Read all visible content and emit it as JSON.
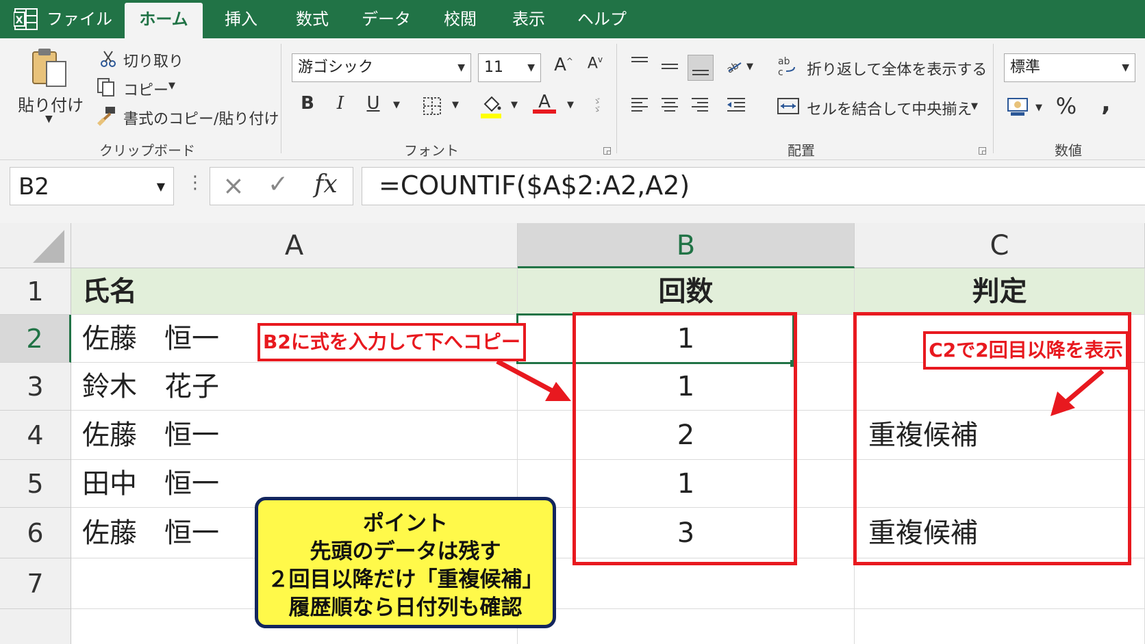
{
  "window": {
    "icon": "excel-logo-icon"
  },
  "tabs": [
    {
      "label": "ファイル",
      "active": false
    },
    {
      "label": "ホーム",
      "active": true
    },
    {
      "label": "挿入",
      "active": false
    },
    {
      "label": "数式",
      "active": false
    },
    {
      "label": "データ",
      "active": false
    },
    {
      "label": "校閲",
      "active": false
    },
    {
      "label": "表示",
      "active": false
    },
    {
      "label": "ヘルプ",
      "active": false
    }
  ],
  "ribbon": {
    "clipboard": {
      "paste_label": "貼り付け",
      "cut_label": "切り取り",
      "copy_label": "コピー",
      "format_painter_label": "書式のコピー/貼り付け",
      "group_label": "クリップボード"
    },
    "font": {
      "font_name": "游ゴシック",
      "font_size": "11",
      "grow_label": "A",
      "shrink_label": "A",
      "bold_label": "B",
      "italic_label": "I",
      "underline_label": "U",
      "font_color_label": "A",
      "group_label": "フォント",
      "highlight_color": "#ffff00",
      "font_color": "#e8191f"
    },
    "alignment": {
      "wrap_label": "折り返して全体を表示する",
      "merge_label": "セルを結合して中央揃え",
      "group_label": "配置"
    },
    "number": {
      "format": "標準",
      "percent_label": "%",
      "comma_label": ",",
      "group_label": "数値"
    }
  },
  "formula_bar": {
    "name_box": "B2",
    "cancel_icon": "×",
    "enter_icon": "✓",
    "fx_label": "fx",
    "formula": "=COUNTIF($A$2:A2,A2)"
  },
  "sheet": {
    "columns": [
      "A",
      "B",
      "C"
    ],
    "selected_column": "B",
    "selected_cell": "B2",
    "rows": [
      {
        "num": "1",
        "a": "氏名",
        "b": "回数",
        "c": "判定"
      },
      {
        "num": "2",
        "a": "佐藤　恒一",
        "b": "1",
        "c": ""
      },
      {
        "num": "3",
        "a": "鈴木　花子",
        "b": "1",
        "c": ""
      },
      {
        "num": "4",
        "a": "佐藤　恒一",
        "b": "2",
        "c": "重複候補"
      },
      {
        "num": "5",
        "a": "田中　恒一",
        "b": "1",
        "c": ""
      },
      {
        "num": "6",
        "a": "佐藤　恒一",
        "b": "3",
        "c": "重複候補"
      },
      {
        "num": "7",
        "a": "",
        "b": "",
        "c": ""
      }
    ]
  },
  "annotations": {
    "callout_b": "B2に式を入力して下へコピー",
    "callout_c": "C2で2回目以降を表示",
    "note_lines": [
      "ポイント",
      "先頭のデータは残す",
      "２回目以降だけ「重複候補」",
      "履歴順なら日付列も確認"
    ],
    "accent_color": "#e8191f",
    "note_bg": "#fff94a"
  },
  "theme": {
    "excel_green": "#217346",
    "header_fill": "#e2efda"
  }
}
